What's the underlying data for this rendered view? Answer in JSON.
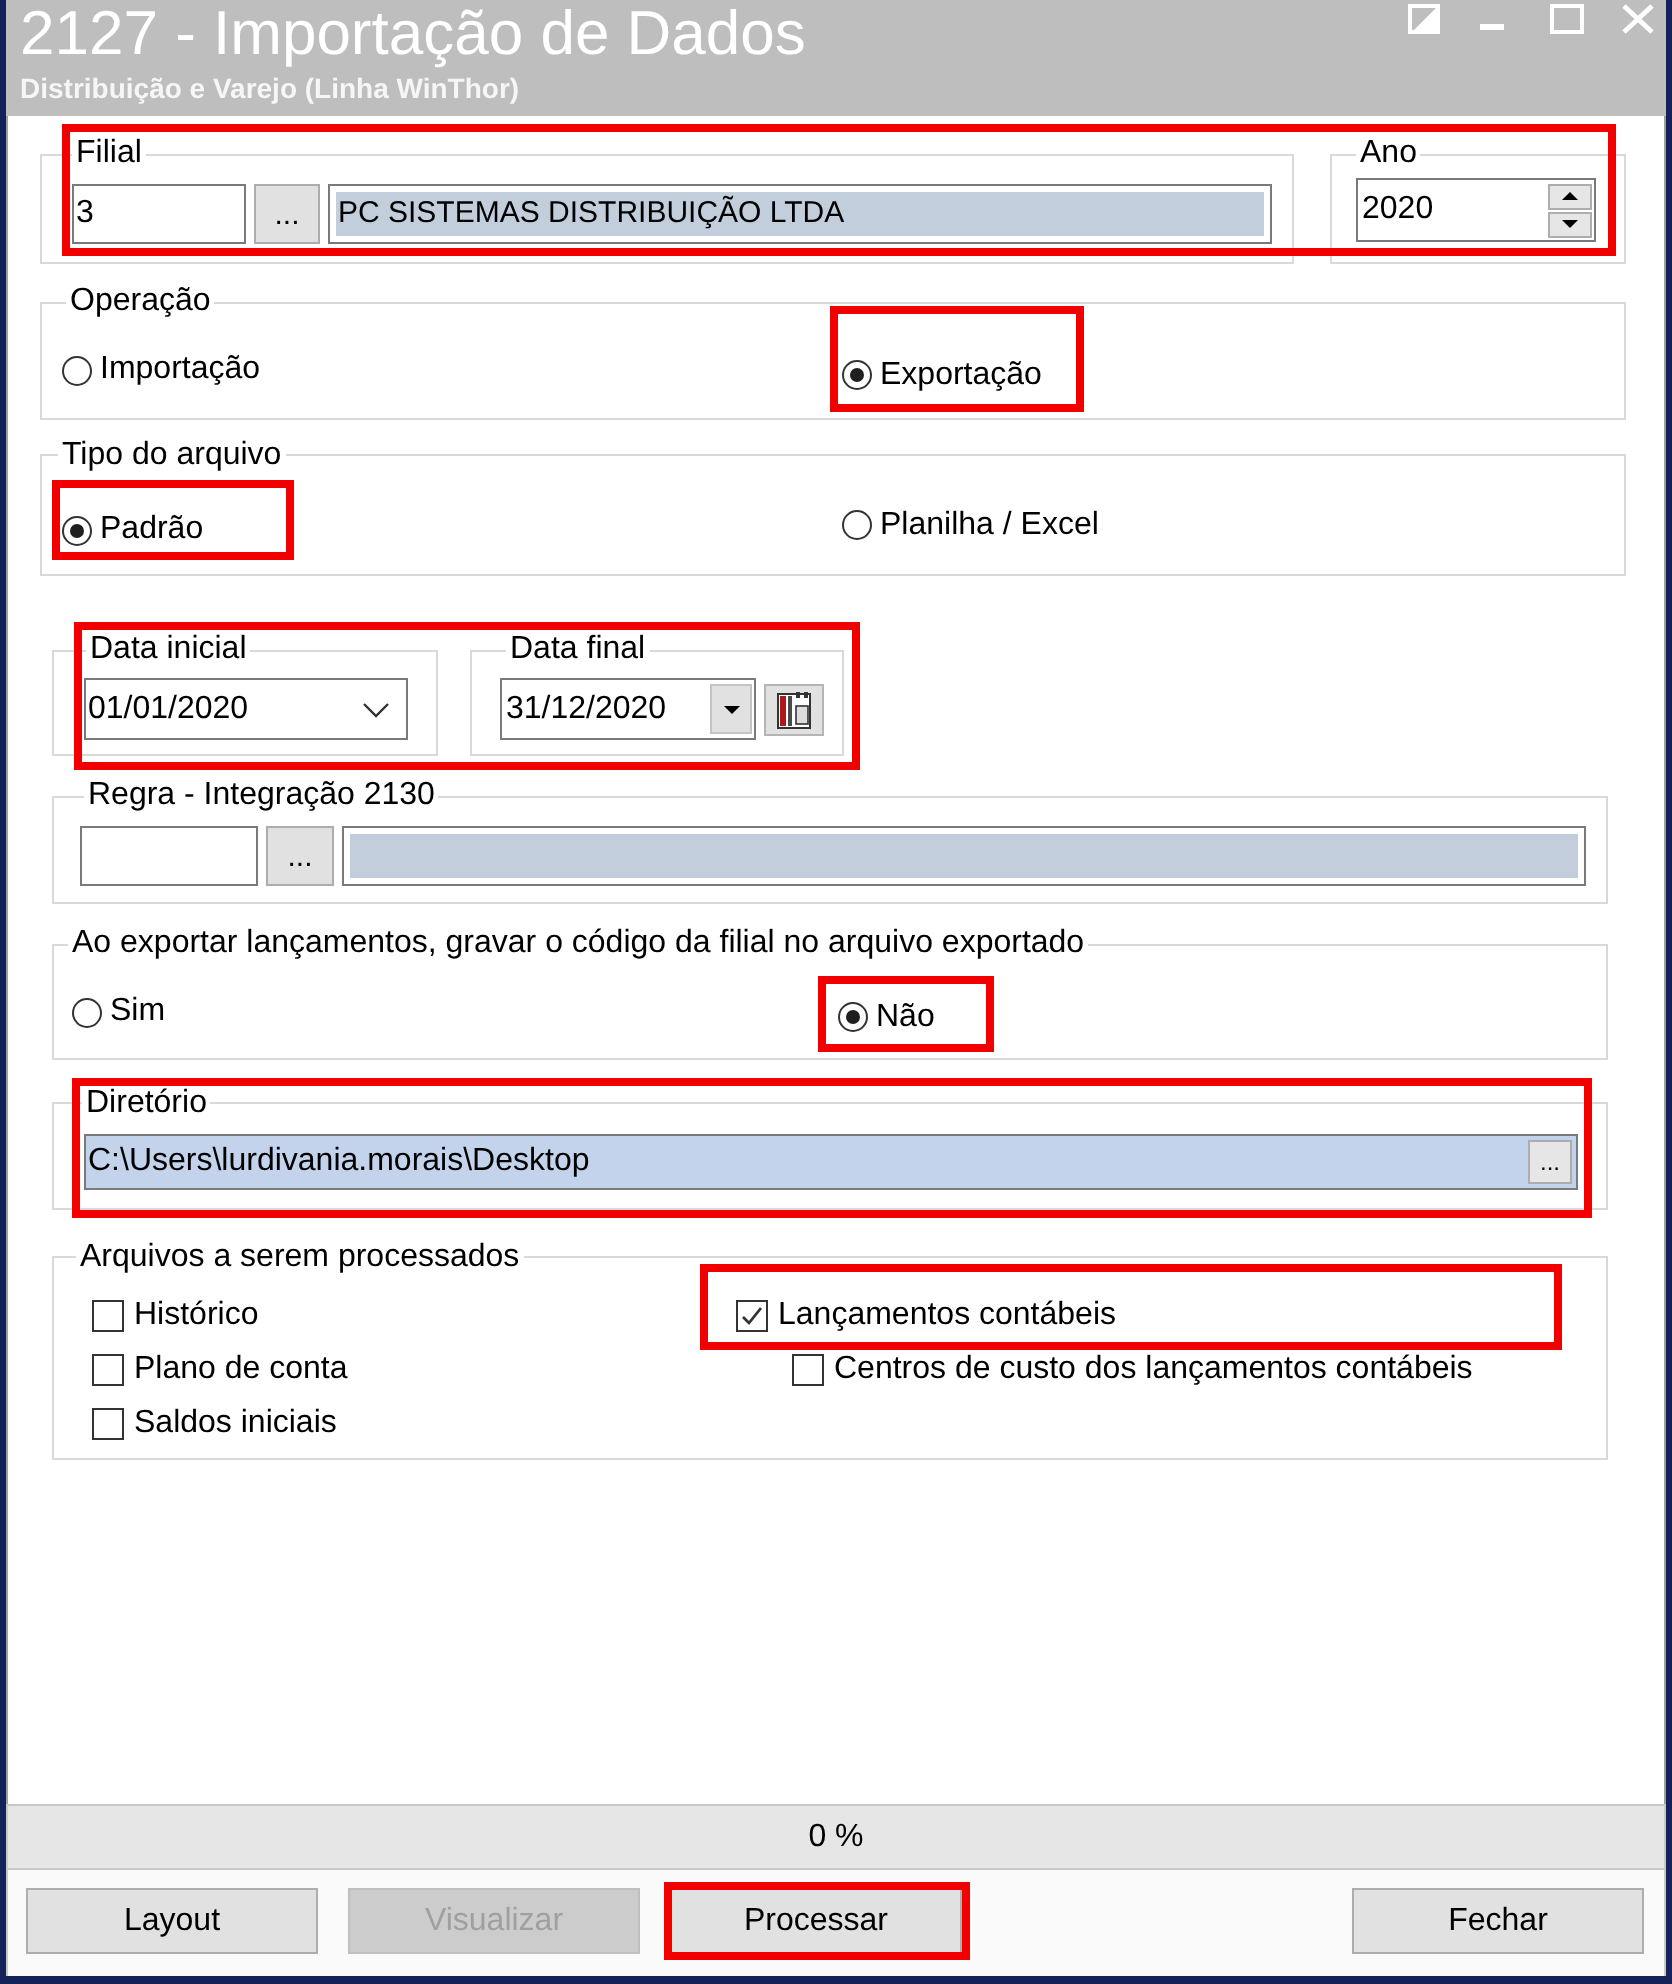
{
  "window": {
    "title": "2127 - Importação de Dados",
    "subtitle": "Distribuição e Varejo (Linha WinThor)"
  },
  "filial_row": {
    "highlighted": true,
    "filial": {
      "legend": "Filial",
      "code": "3",
      "lookup_button": "...",
      "name": "PC SISTEMAS DISTRIBUIÇÃO LTDA"
    },
    "ano": {
      "legend": "Ano",
      "value": "2020"
    }
  },
  "operacao": {
    "legend": "Operação",
    "options": [
      {
        "label": "Importação",
        "selected": false,
        "highlighted": false
      },
      {
        "label": "Exportação",
        "selected": true,
        "highlighted": true
      }
    ]
  },
  "tipo_arquivo": {
    "legend": "Tipo do arquivo",
    "options": [
      {
        "label": "Padrão",
        "selected": true,
        "highlighted": true
      },
      {
        "label": "Planilha / Excel",
        "selected": false,
        "highlighted": false
      }
    ]
  },
  "periodo": {
    "highlighted": true,
    "data_inicial": {
      "legend": "Data inicial",
      "value": "01/01/2020"
    },
    "data_final": {
      "legend": "Data final",
      "value": "31/12/2020"
    }
  },
  "regra": {
    "legend": "Regra - Integração 2130",
    "lookup_button": "..."
  },
  "gravar_codigo_filial": {
    "legend": "Ao exportar lançamentos, gravar o código da filial no arquivo exportado",
    "options": [
      {
        "label": "Sim",
        "selected": false,
        "highlighted": false
      },
      {
        "label": "Não",
        "selected": true,
        "highlighted": true
      }
    ]
  },
  "diretorio": {
    "legend": "Diretório",
    "value": "C:\\Users\\lurdivania.morais\\Desktop",
    "browse_button": "...",
    "highlighted": true
  },
  "arquivos": {
    "legend": "Arquivos a serem processados",
    "columns": [
      {
        "items": [
          {
            "label": "Histórico",
            "checked": false,
            "highlighted": false
          },
          {
            "label": "Plano de conta",
            "checked": false,
            "highlighted": false
          },
          {
            "label": "Saldos iniciais",
            "checked": false,
            "highlighted": false
          }
        ]
      },
      {
        "items": [
          {
            "label": "Lançamentos contábeis",
            "checked": true,
            "highlighted": true,
            "children": [
              {
                "label": "Centros de custo dos lançamentos contábeis",
                "checked": false,
                "highlighted": false
              }
            ]
          }
        ]
      }
    ]
  },
  "progress": {
    "text": "0 %",
    "level": 0
  },
  "buttons": [
    {
      "label": "Layout",
      "disabled": false,
      "highlighted": false
    },
    {
      "label": "Visualizar",
      "disabled": true,
      "highlighted": false
    },
    {
      "label": "Processar",
      "disabled": false,
      "highlighted": true
    },
    {
      "label": "Fechar",
      "disabled": false,
      "highlighted": false
    }
  ]
}
